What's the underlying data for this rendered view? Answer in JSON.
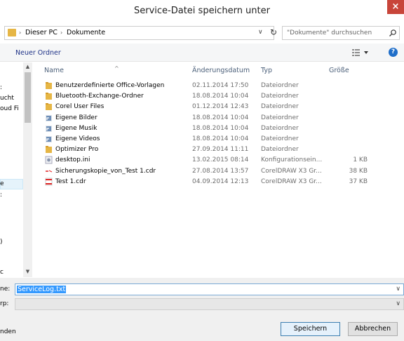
{
  "window": {
    "title": "Service-Datei speichern unter",
    "close_glyph": "×"
  },
  "address": {
    "segments": [
      "Dieser PC",
      "Dokumente"
    ],
    "separator": "›"
  },
  "search": {
    "placeholder": "\"Dokumente\" durchsuchen"
  },
  "toolbar": {
    "new_folder": "Neuer Ordner"
  },
  "nav": {
    "items": [
      ":",
      "ucht",
      "oud Fi",
      "e",
      ":",
      ")",
      "c"
    ]
  },
  "columns": {
    "name": "Name",
    "date": "Änderungsdatum",
    "type": "Typ",
    "size": "Größe"
  },
  "files": [
    {
      "name": "Benutzerdefinierte Office-Vorlagen",
      "date": "02.11.2014 17:50",
      "type": "Dateiordner",
      "size": "",
      "icon": "folder-icon"
    },
    {
      "name": "Bluetooth-Exchange-Ordner",
      "date": "18.08.2014 10:04",
      "type": "Dateiordner",
      "size": "",
      "icon": "folder-icon"
    },
    {
      "name": "Corel User Files",
      "date": "01.12.2014 12:43",
      "type": "Dateiordner",
      "size": "",
      "icon": "folder-icon"
    },
    {
      "name": "Eigene Bilder",
      "date": "18.08.2014 10:04",
      "type": "Dateiordner",
      "size": "",
      "icon": "shortcut-folder-icon"
    },
    {
      "name": "Eigene Musik",
      "date": "18.08.2014 10:04",
      "type": "Dateiordner",
      "size": "",
      "icon": "shortcut-folder-icon"
    },
    {
      "name": "Eigene Videos",
      "date": "18.08.2014 10:04",
      "type": "Dateiordner",
      "size": "",
      "icon": "shortcut-folder-icon"
    },
    {
      "name": "Optimizer Pro",
      "date": "27.09.2014 11:11",
      "type": "Dateiordner",
      "size": "",
      "icon": "folder-icon"
    },
    {
      "name": "desktop.ini",
      "date": "13.02.2015 08:14",
      "type": "Konfigurationsein...",
      "size": "1 KB",
      "icon": "settings-file-icon"
    },
    {
      "name": "Sicherungskopie_von_Test 1.cdr",
      "date": "27.08.2014 13:57",
      "type": "CorelDRAW X3 Gr...",
      "size": "38 KB",
      "icon": "cdr-backup-file-icon"
    },
    {
      "name": "Test 1.cdr",
      "date": "04.09.2014 12:13",
      "type": "CorelDRAW X3 Gr...",
      "size": "37 KB",
      "icon": "cdr-file-icon"
    }
  ],
  "form": {
    "filename_label": "ne:",
    "filename_value": "ServiceLog.txt",
    "filetype_label": "rp:",
    "filetype_value": "",
    "hide_folders_label": "nden"
  },
  "buttons": {
    "save": "Speichern",
    "cancel": "Abbrechen"
  },
  "colors": {
    "close": "#c8453a",
    "folder": "#e6b645",
    "selection": "#3399ff",
    "link": "#1e3287"
  }
}
